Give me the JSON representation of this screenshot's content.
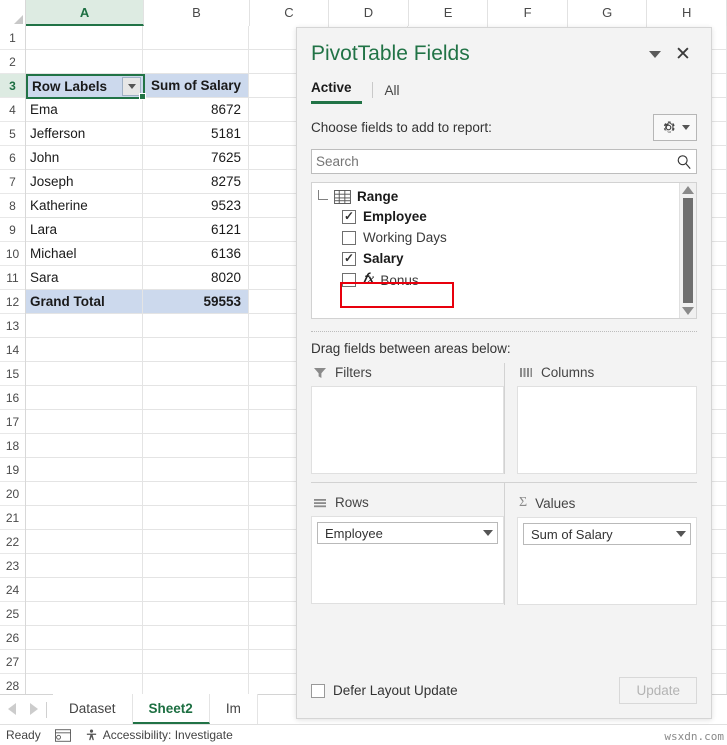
{
  "spreadsheet": {
    "columns": [
      "A",
      "B",
      "C",
      "D",
      "E",
      "F",
      "G",
      "H"
    ],
    "active_column": "A",
    "active_row": 3,
    "row_numbers": [
      1,
      2,
      3,
      4,
      5,
      6,
      7,
      8,
      9,
      10,
      11,
      12,
      13,
      14,
      15,
      16,
      17,
      18,
      19,
      20,
      21,
      22,
      23,
      24,
      25,
      26,
      27,
      28
    ],
    "active_cell": {
      "ref": "A3",
      "text": "Row Labels",
      "filter_icon": "filter-dropdown-icon"
    },
    "pivot_table": {
      "header_row": [
        "Row Labels",
        "Sum of Salary"
      ],
      "rows": [
        {
          "label": "Ema",
          "value": "8672"
        },
        {
          "label": "Jefferson",
          "value": "5181"
        },
        {
          "label": "John",
          "value": "7625"
        },
        {
          "label": "Joseph",
          "value": "8275"
        },
        {
          "label": "Katherine",
          "value": "9523"
        },
        {
          "label": "Lara",
          "value": "6121"
        },
        {
          "label": "Michael",
          "value": "6136"
        },
        {
          "label": "Sara",
          "value": "8020"
        }
      ],
      "grand_total": {
        "label": "Grand Total",
        "value": "59553"
      }
    }
  },
  "sheet_bar": {
    "prev_icon": "arrow-left-icon",
    "next_icon": "arrow-right-icon",
    "tabs": [
      {
        "label": "Dataset",
        "active": false
      },
      {
        "label": "Sheet2",
        "active": true
      },
      {
        "label": "Im",
        "active": false
      }
    ]
  },
  "status_bar": {
    "ready_text": "Ready",
    "recording_icon": "record-macro-icon",
    "accessibility_icon": "accessibility-icon",
    "accessibility_text": "Accessibility: Investigate"
  },
  "watermark": "wsxdn.com",
  "pivot_panel": {
    "title": "PivotTable Fields",
    "collapse_icon": "chevron-down-icon",
    "close_icon": "close-icon",
    "tabs": [
      {
        "label": "Active",
        "active": true
      },
      {
        "label": "All",
        "active": false
      }
    ],
    "choose_label": "Choose fields to add to report:",
    "tools_icon": "gear-icon",
    "tools_chevron_icon": "chevron-down-icon",
    "search": {
      "placeholder": "Search",
      "value": "",
      "icon": "search-icon"
    },
    "field_list": {
      "root": {
        "label": "Range",
        "icon": "table-icon"
      },
      "fields": [
        {
          "label": "Employee",
          "checked": true,
          "calculated": false
        },
        {
          "label": "Working Days",
          "checked": false,
          "calculated": false
        },
        {
          "label": "Salary",
          "checked": true,
          "calculated": false
        },
        {
          "label": "Bonus",
          "checked": false,
          "calculated": true,
          "fx_icon": "fx-icon",
          "highlighted": true
        }
      ],
      "scrollbar": {
        "up_icon": "scroll-up-arrow-icon",
        "down_icon": "scroll-down-arrow-icon"
      },
      "highlight_color": "#e8000d"
    },
    "drag_label": "Drag fields between areas below:",
    "areas": [
      {
        "name": "Filters",
        "icon": "filter-funnel-icon",
        "fields": []
      },
      {
        "name": "Columns",
        "icon": "columns-icon",
        "fields": []
      },
      {
        "name": "Rows",
        "icon": "rows-icon",
        "fields": [
          "Employee"
        ]
      },
      {
        "name": "Values",
        "icon": "sigma-icon",
        "fields": [
          "Sum of Salary"
        ]
      }
    ],
    "defer": {
      "label": "Defer Layout Update",
      "checked": false
    },
    "update_button": {
      "label": "Update",
      "enabled": false
    }
  },
  "colors": {
    "excel_green": "#217346",
    "pivot_header_fill": "#ccd9ed",
    "highlight_red": "#e8000d",
    "panel_bg": "#f3f3f3"
  }
}
